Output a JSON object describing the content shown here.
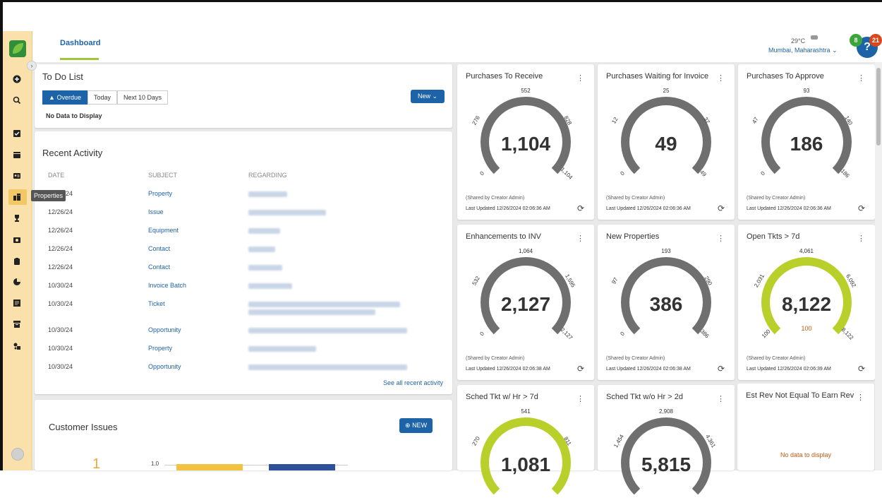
{
  "header": {
    "tab": "Dashboard",
    "weather_temp": "29°C",
    "weather_city": "Mumbai, Maharashtra",
    "help_label": "?",
    "badge_green": "8",
    "badge_red": "21"
  },
  "sidebar": {
    "tooltip": "Properties",
    "icons": [
      "add-icon",
      "search-icon",
      "checklist-icon",
      "calendar-icon",
      "contact-card-icon",
      "properties-icon",
      "trophy-icon",
      "money-icon",
      "clipboard-icon",
      "pie-chart-icon",
      "ledger-icon",
      "archive-icon",
      "settings-icon"
    ]
  },
  "todo": {
    "title": "To Do List",
    "filters": [
      "Overdue",
      "Today",
      "Next 10 Days"
    ],
    "new_label": "New",
    "empty": "No Data to Display"
  },
  "recent": {
    "title": "Recent Activity",
    "columns": [
      "DATE",
      "SUBJECT",
      "REGARDING"
    ],
    "rows": [
      {
        "date": "12/26/24",
        "subject": "Property"
      },
      {
        "date": "12/26/24",
        "subject": "Issue"
      },
      {
        "date": "12/26/24",
        "subject": "Equipment"
      },
      {
        "date": "12/26/24",
        "subject": "Contact"
      },
      {
        "date": "12/26/24",
        "subject": "Contact"
      },
      {
        "date": "10/30/24",
        "subject": "Invoice Batch"
      },
      {
        "date": "10/30/24",
        "subject": "Ticket"
      },
      {
        "date": "10/30/24",
        "subject": "Opportunity"
      },
      {
        "date": "10/30/24",
        "subject": "Property"
      },
      {
        "date": "10/30/24",
        "subject": "Opportunity"
      }
    ],
    "see_all": "See all recent activity"
  },
  "issues": {
    "title": "Customer Issues",
    "new_label": "NEW",
    "big_number": "1",
    "axis_label": "1.0"
  },
  "gauges": [
    {
      "title": "Purchases To Receive",
      "value": "1,104",
      "top": "552",
      "left": "276",
      "right": "828",
      "min": "0",
      "max": "1,104",
      "fill": 0,
      "fill_color": "#6f6f6f",
      "shared": "(Shared by Creator Admin)",
      "updated": "Last Updated 12/26/2024 02:06:36 AM"
    },
    {
      "title": "Purchases Waiting for Invoice",
      "value": "49",
      "top": "25",
      "left": "12",
      "right": "37",
      "min": "0",
      "max": "49",
      "fill": 0,
      "fill_color": "#6f6f6f",
      "shared": "(Shared by Creator Admin)",
      "updated": "Last Updated 12/26/2024 02:06:36 AM"
    },
    {
      "title": "Purchases To Approve",
      "value": "186",
      "top": "93",
      "left": "47",
      "right": "140",
      "min": "0",
      "max": "186",
      "fill": 0,
      "fill_color": "#6f6f6f",
      "shared": "(Shared by Creator Admin)",
      "updated": "Last Updated 12/26/2024 02:06:36 AM"
    },
    {
      "title": "Enhancements to INV",
      "value": "2,127",
      "top": "1,064",
      "left": "532",
      "right": "1,595",
      "min": "0",
      "max": "2,127",
      "fill": 0,
      "fill_color": "#6f6f6f",
      "shared": "(Shared by Creator Admin)",
      "updated": "Last Updated 12/26/2024 02:06:38 AM"
    },
    {
      "title": "New Properties",
      "value": "386",
      "top": "193",
      "left": "97",
      "right": "290",
      "min": "0",
      "max": "386",
      "fill": 0,
      "fill_color": "#6f6f6f",
      "shared": "(Shared by Creator Admin)",
      "updated": "Last Updated 12/26/2024 02:06:38 AM"
    },
    {
      "title": "Open Tkts > 7d",
      "value": "8,122",
      "top": "4,061",
      "left": "2,031",
      "right": "6,092",
      "min": "100",
      "max": "8,122",
      "target": "100",
      "fill": 1,
      "fill_color": "#b9cf2a",
      "shared": "(Shared by Creator Admin)",
      "updated": "Last Updated 12/26/2024 02:06:39 AM"
    },
    {
      "title": "Sched Tkt w/ Hr > 7d",
      "value": "1,081",
      "top": "541",
      "left": "270",
      "right": "811",
      "fill": 1,
      "fill_color": "#b9cf2a"
    },
    {
      "title": "Sched Tkt w/o Hr > 2d",
      "value": "5,815",
      "top": "2,908",
      "left": "1,454",
      "right": "4,361",
      "fill": 0,
      "fill_color": "#6f6f6f"
    }
  ],
  "est_rev": {
    "title": "Est Rev Not Equal To Earn Rev",
    "empty": "No data to display"
  }
}
